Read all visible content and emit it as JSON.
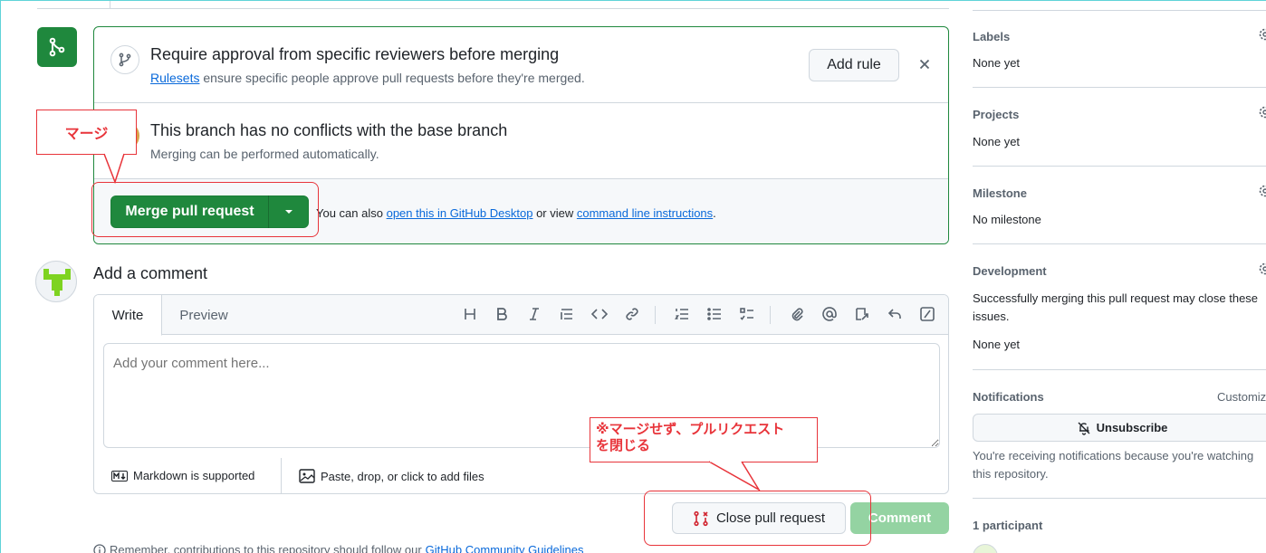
{
  "merge_section": {
    "ruleset_title": "Require approval from specific reviewers before merging",
    "ruleset_link": "Rulesets",
    "ruleset_desc": " ensure specific people approve pull requests before they're merged.",
    "add_rule_label": "Add rule",
    "conflict_title": "This branch has no conflicts with the base branch",
    "conflict_desc": "Merging can be performed automatically.",
    "merge_button_label": "Merge pull request",
    "hint_prefix": "You can also ",
    "hint_link1": "open this in GitHub Desktop",
    "hint_mid": " or view ",
    "hint_link2": "command line instructions",
    "hint_suffix": "."
  },
  "comment": {
    "heading": "Add a comment",
    "tab_write": "Write",
    "tab_preview": "Preview",
    "placeholder": "Add your comment here...",
    "markdown_label": "Markdown is supported",
    "attach_label": "Paste, drop, or click to add files",
    "close_pr_label": "Close pull request",
    "comment_button_label": "Comment",
    "guidelines_prefix": "Remember, contributions to this repository should follow our ",
    "guidelines_link": "GitHub Community Guidelines"
  },
  "toolbar_icons": [
    "heading-icon",
    "bold-icon",
    "italic-icon",
    "quote-icon",
    "code-icon",
    "link-icon",
    "numbered-list-icon",
    "unordered-list-icon",
    "task-list-icon",
    "attach-icon",
    "mention-icon",
    "reference-icon",
    "reply-icon",
    "slash-command-icon"
  ],
  "sidebar": {
    "labels_title": "Labels",
    "labels_value": "None yet",
    "projects_title": "Projects",
    "projects_value": "None yet",
    "milestone_title": "Milestone",
    "milestone_value": "No milestone",
    "development_title": "Development",
    "development_desc_line1": "Successfully merging this pull request may close these",
    "development_desc_line2": "issues.",
    "development_value": "None yet",
    "notifications_title": "Notifications",
    "notifications_customize": "Customize",
    "unsubscribe_label": "Unsubscribe",
    "notif_desc_line1": "You're receiving notifications because you're watching",
    "notif_desc_line2": "this repository.",
    "participants_title": "1 participant"
  },
  "annotations": {
    "merge_callout": "マージ",
    "close_callout_line1": "※マージせず、プルリクエスト",
    "close_callout_line2": "を閉じる"
  },
  "colors": {
    "green": "#1f883d",
    "annotation_red": "#e8343a",
    "link_blue": "#0969da"
  }
}
